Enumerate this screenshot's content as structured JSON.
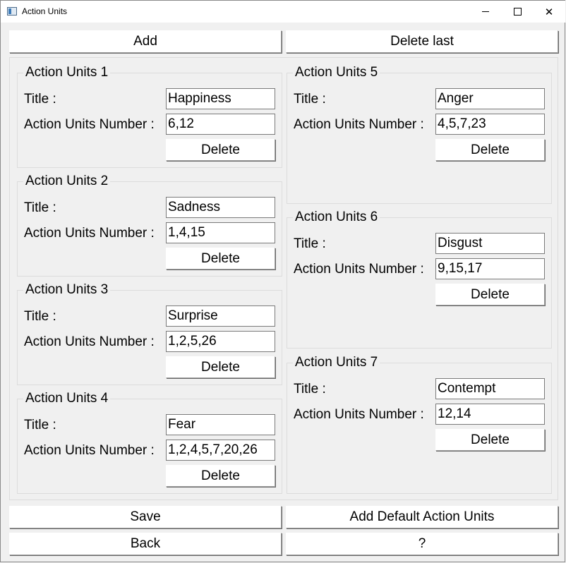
{
  "window": {
    "title": "Action Units"
  },
  "toolbar": {
    "add_label": "Add",
    "delete_last_label": "Delete last"
  },
  "labels": {
    "title": "Title :",
    "number": "Action Units Number :",
    "delete": "Delete"
  },
  "units": [
    {
      "name": "Action Units 1",
      "title": "Happiness",
      "number": "6,12"
    },
    {
      "name": "Action Units 2",
      "title": "Sadness",
      "number": "1,4,15"
    },
    {
      "name": "Action Units 3",
      "title": "Surprise",
      "number": "1,2,5,26"
    },
    {
      "name": "Action Units 4",
      "title": "Fear",
      "number": "1,2,4,5,7,20,26"
    },
    {
      "name": "Action Units 5",
      "title": "Anger",
      "number": "4,5,7,23"
    },
    {
      "name": "Action Units 6",
      "title": "Disgust",
      "number": "9,15,17"
    },
    {
      "name": "Action Units 7",
      "title": "Contempt",
      "number": "12,14"
    }
  ],
  "footer": {
    "save_label": "Save",
    "add_default_label": "Add Default Action Units",
    "back_label": "Back",
    "help_label": "?"
  }
}
